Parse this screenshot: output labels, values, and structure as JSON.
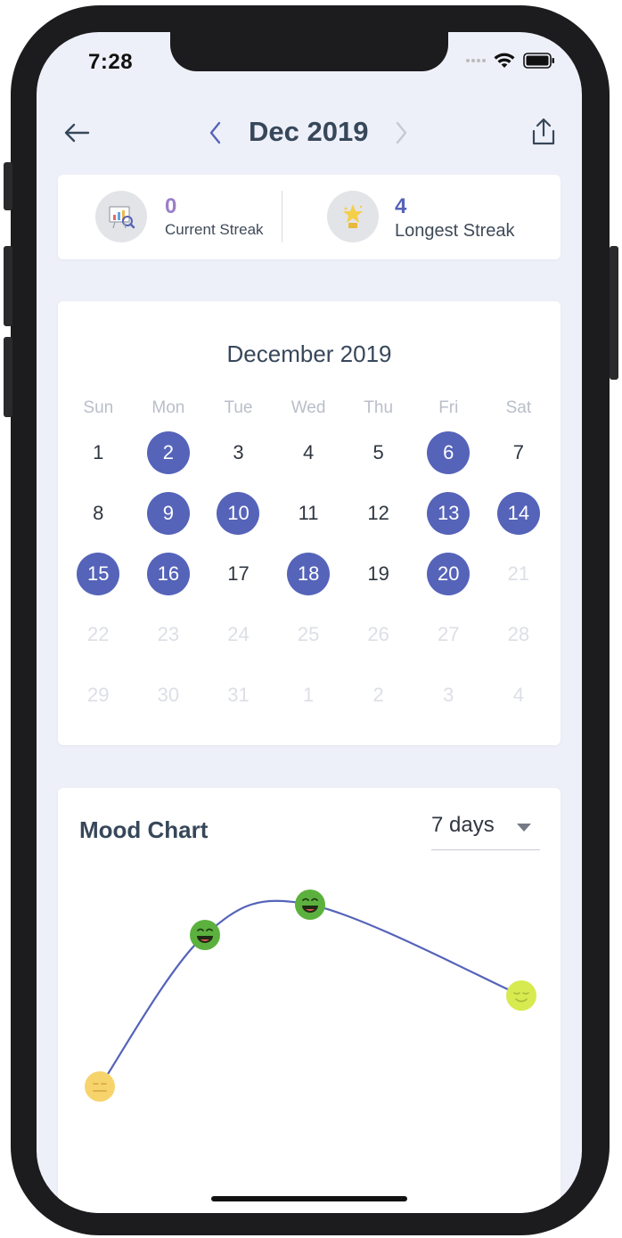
{
  "status_bar": {
    "time": "7:28"
  },
  "header": {
    "title": "Dec 2019"
  },
  "streaks": {
    "current": {
      "value": "0",
      "label": "Current Streak"
    },
    "longest": {
      "value": "4",
      "label": "Longest Streak"
    }
  },
  "calendar": {
    "title": "December 2019",
    "weekdays": [
      "Sun",
      "Mon",
      "Tue",
      "Wed",
      "Thu",
      "Fri",
      "Sat"
    ],
    "days": [
      {
        "d": "1",
        "s": "normal"
      },
      {
        "d": "2",
        "s": "selected"
      },
      {
        "d": "3",
        "s": "normal"
      },
      {
        "d": "4",
        "s": "normal"
      },
      {
        "d": "5",
        "s": "normal"
      },
      {
        "d": "6",
        "s": "selected"
      },
      {
        "d": "7",
        "s": "normal"
      },
      {
        "d": "8",
        "s": "normal"
      },
      {
        "d": "9",
        "s": "selected"
      },
      {
        "d": "10",
        "s": "selected"
      },
      {
        "d": "11",
        "s": "normal"
      },
      {
        "d": "12",
        "s": "normal"
      },
      {
        "d": "13",
        "s": "selected"
      },
      {
        "d": "14",
        "s": "selected"
      },
      {
        "d": "15",
        "s": "selected"
      },
      {
        "d": "16",
        "s": "selected"
      },
      {
        "d": "17",
        "s": "normal"
      },
      {
        "d": "18",
        "s": "selected"
      },
      {
        "d": "19",
        "s": "normal"
      },
      {
        "d": "20",
        "s": "selected"
      },
      {
        "d": "21",
        "s": "outside"
      },
      {
        "d": "22",
        "s": "outside"
      },
      {
        "d": "23",
        "s": "outside"
      },
      {
        "d": "24",
        "s": "outside"
      },
      {
        "d": "25",
        "s": "outside"
      },
      {
        "d": "26",
        "s": "outside"
      },
      {
        "d": "27",
        "s": "outside"
      },
      {
        "d": "28",
        "s": "outside"
      },
      {
        "d": "29",
        "s": "outside"
      },
      {
        "d": "30",
        "s": "outside"
      },
      {
        "d": "31",
        "s": "outside"
      },
      {
        "d": "1",
        "s": "outside"
      },
      {
        "d": "2",
        "s": "outside"
      },
      {
        "d": "3",
        "s": "outside"
      },
      {
        "d": "4",
        "s": "outside"
      }
    ]
  },
  "mood_chart": {
    "title": "Mood Chart",
    "range": {
      "selected": "7 days"
    },
    "chart_data": {
      "type": "line",
      "points": [
        {
          "mood": "neutral",
          "level": 2,
          "color": "#f7d36b"
        },
        {
          "mood": "laughing",
          "level": 4,
          "color": "#5cb13e"
        },
        {
          "mood": "laughing",
          "level": 4.4,
          "color": "#5cb13e"
        },
        {
          "mood": "content",
          "level": 3.2,
          "color": "#d7ea4f"
        }
      ],
      "line_color": "#5563b9"
    }
  }
}
